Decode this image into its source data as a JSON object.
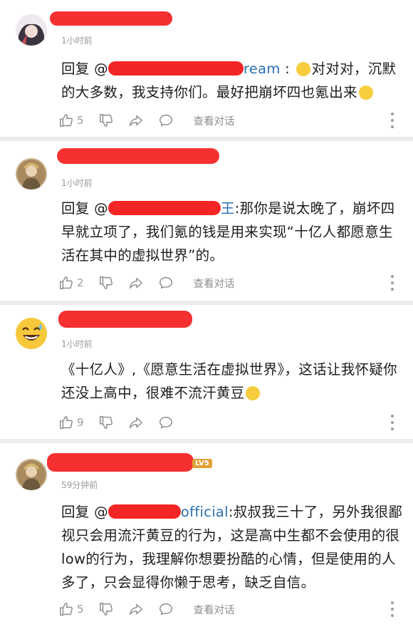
{
  "comments": [
    {
      "time": "1小时前",
      "reply_prefix": "回复 @",
      "reply_visible": "ream",
      "text_main": "对对对，沉默的大多数，我支持你们。最好把崩坏四也氪出来",
      "likes": "5",
      "view_label": "查看对话"
    },
    {
      "time": "1小时前",
      "reply_prefix": "回复 @",
      "reply_visible": "王",
      "text_main": ":那你是说太晚了，崩坏四早就立项了，我们氪的钱是用来实现“十亿人都愿意生活在其中的虚拟世界”的。",
      "likes": "2",
      "view_label": "查看对话"
    },
    {
      "time": "1小时前",
      "text_main": "《十亿人》,《愿意生活在虚拟世界》，这话让我怀疑你还没上高中，很难不流汗黄豆",
      "likes": "9"
    },
    {
      "time": "59分钟前",
      "badge": "LV5",
      "reply_prefix": "回复 @",
      "reply_visible": "official",
      "text_main": ":叔叔我三十了，另外我很鄙视只会用流汗黄豆的行为，这是高中生都不会使用的很low的行为，我理解你想要扮酷的心情，但是使用的人多了，只会显得你懒于思考，缺乏自信。",
      "likes": "5",
      "view_label": "查看对话"
    }
  ],
  "icons": {
    "like": "thumbs-up-icon",
    "dislike": "thumbs-down-icon",
    "share": "share-icon",
    "comment": "comment-bubble-icon",
    "more": "more-vertical-icon"
  },
  "colors": {
    "redaction": "#f42525",
    "mention": "#2b6fb2",
    "meta_gray": "#9a9a9a"
  }
}
